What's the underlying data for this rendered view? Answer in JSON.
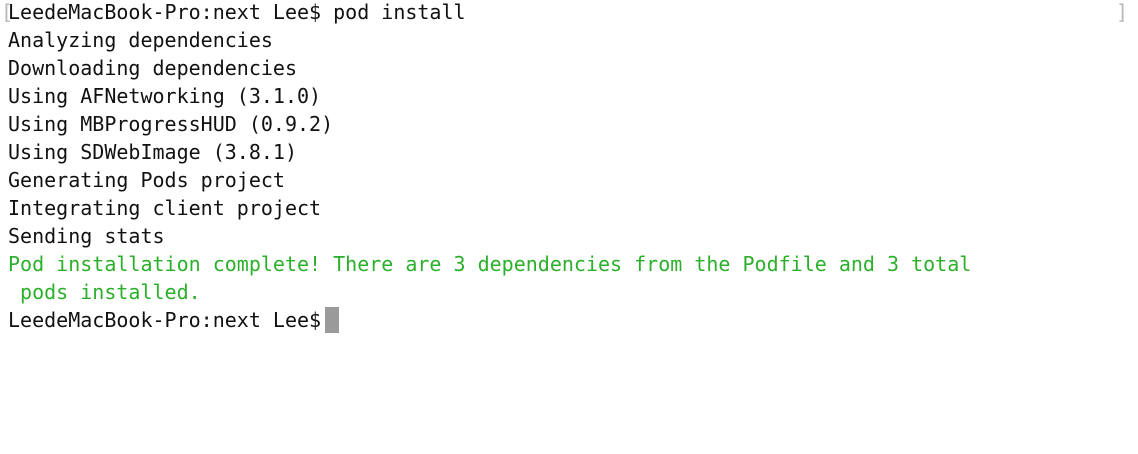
{
  "terminal": {
    "bracket_left": "[",
    "bracket_right": "]",
    "lines": [
      "LeedeMacBook-Pro:next Lee$ pod install",
      "Analyzing dependencies",
      "Downloading dependencies",
      "Using AFNetworking (3.1.0)",
      "Using MBProgressHUD (0.9.2)",
      "Using SDWebImage (3.8.1)",
      "Generating Pods project",
      "Integrating client project",
      "Sending stats"
    ],
    "success_lines": [
      "Pod installation complete! There are 3 dependencies from the Podfile and 3 total",
      " pods installed."
    ],
    "prompt": "LeedeMacBook-Pro:next Lee$",
    "colors": {
      "text": "#111111",
      "success": "#2bb02b",
      "cursor": "#9a9a9a",
      "bracket": "#b8b8b8"
    }
  }
}
